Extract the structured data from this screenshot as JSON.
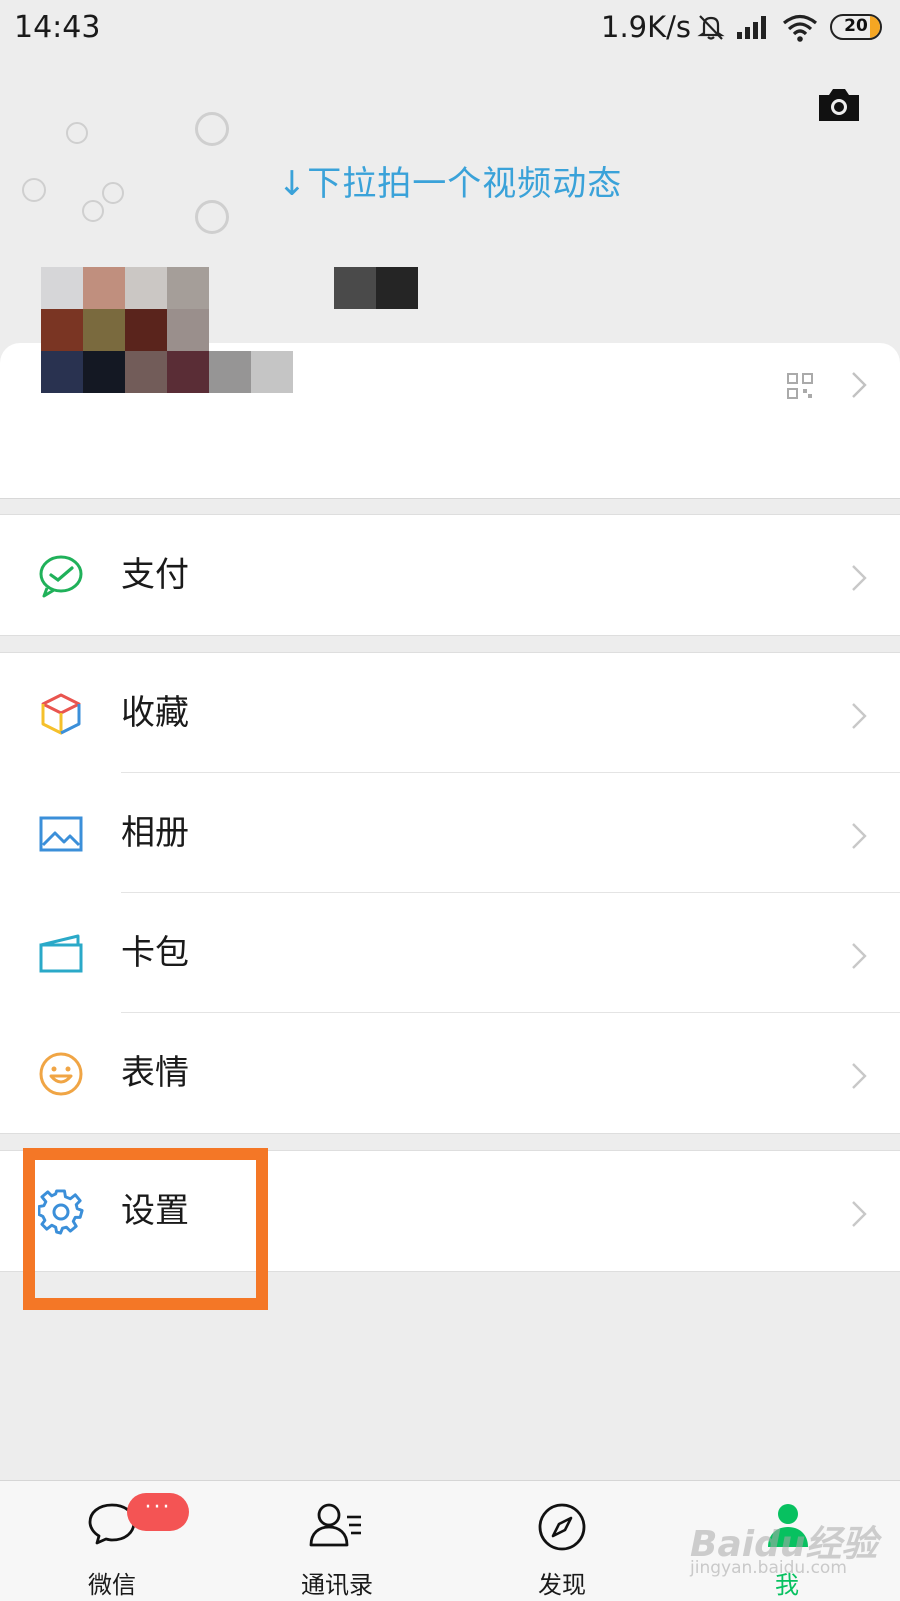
{
  "status_bar": {
    "time": "14:43",
    "network_speed": "1.9K/s",
    "battery_level": "20",
    "icons": [
      "bell-muted-icon",
      "signal-icon",
      "wifi-icon",
      "battery-icon"
    ]
  },
  "header": {
    "pull_hint": "↓下拉拍一个视频动态",
    "camera_icon": "camera-icon"
  },
  "profile": {
    "avatar": "pixelated-avatar",
    "icons": [
      "qr-code-icon",
      "chevron-right-icon"
    ]
  },
  "menu": {
    "pay": {
      "label": "支付",
      "icon": "pay-icon"
    },
    "favorites": {
      "label": "收藏",
      "icon": "favorites-cube-icon"
    },
    "album": {
      "label": "相册",
      "icon": "album-picture-icon"
    },
    "cards": {
      "label": "卡包",
      "icon": "card-wallet-icon"
    },
    "stickers": {
      "label": "表情",
      "icon": "smiley-icon"
    },
    "settings": {
      "label": "设置",
      "icon": "gear-icon"
    }
  },
  "tabs": {
    "chats": {
      "label": "微信",
      "badge": "···"
    },
    "contacts": {
      "label": "通讯录"
    },
    "discover": {
      "label": "发现"
    },
    "me": {
      "label": "我"
    }
  },
  "watermark": {
    "brand": "Baidu经验",
    "url": "jingyan.baidu.com"
  },
  "colors": {
    "accent_green": "#07c160",
    "hint_blue": "#3aa2d9",
    "highlight_orange": "#f47726",
    "badge_red": "#f45454",
    "background": "#ededed"
  }
}
